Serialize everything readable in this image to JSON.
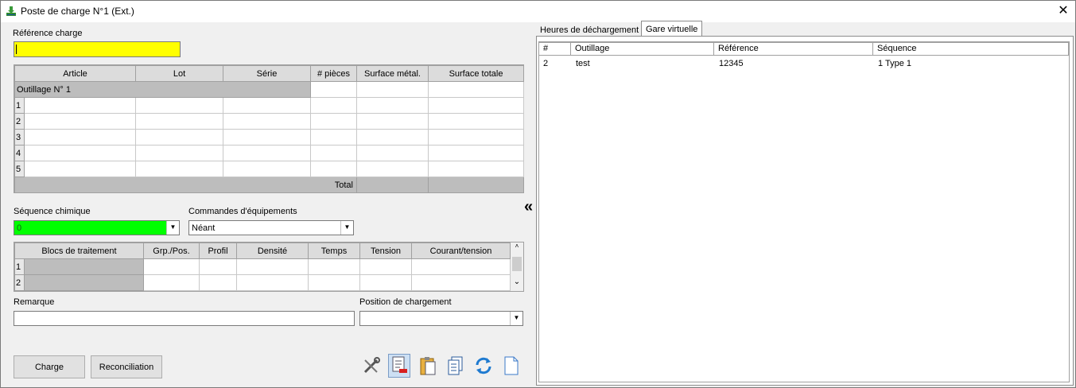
{
  "window": {
    "title": "Poste de charge N°1 (Ext.)",
    "close_symbol": "✕"
  },
  "reference": {
    "label": "Référence charge",
    "value": "",
    "bg": "#ffff00"
  },
  "articles": {
    "headers": [
      "Article",
      "Lot",
      "Série",
      "# pièces",
      "Surface métal.",
      "Surface totale"
    ],
    "group_label": "Outillage N° 1",
    "rows": [
      "1",
      "2",
      "3",
      "4",
      "5"
    ],
    "total_label": "Total"
  },
  "sequence": {
    "label": "Séquence chimique",
    "value": "0",
    "bg": "#00ff00"
  },
  "commands": {
    "label": "Commandes d'équipements",
    "value": "Néant"
  },
  "treatment": {
    "headers": [
      "Blocs de traitement",
      "Grp./Pos.",
      "Profil",
      "Densité",
      "Temps",
      "Tension",
      "Courant/tension"
    ],
    "rows": [
      "1",
      "2"
    ]
  },
  "remark": {
    "label": "Remarque",
    "value": ""
  },
  "load_position": {
    "label": "Position de chargement",
    "value": ""
  },
  "buttons": {
    "charge": "Charge",
    "reconciliation": "Reconciliation"
  },
  "toolbar_icons": [
    "tools-icon",
    "document-edit-icon",
    "clipboard-icon",
    "copy-icon",
    "refresh-icon",
    "new-document-icon"
  ],
  "tabs": [
    {
      "label": "Heures de déchargement",
      "active": false
    },
    {
      "label": "Gare virtuelle",
      "active": true
    }
  ],
  "virtual_station": {
    "headers": [
      "#",
      "Outillage",
      "Référence",
      "Séquence"
    ],
    "rows": [
      {
        "num": "2",
        "tool": "test",
        "ref": "12345",
        "seq": "1 Type 1"
      }
    ]
  },
  "collapse_symbol": "«"
}
